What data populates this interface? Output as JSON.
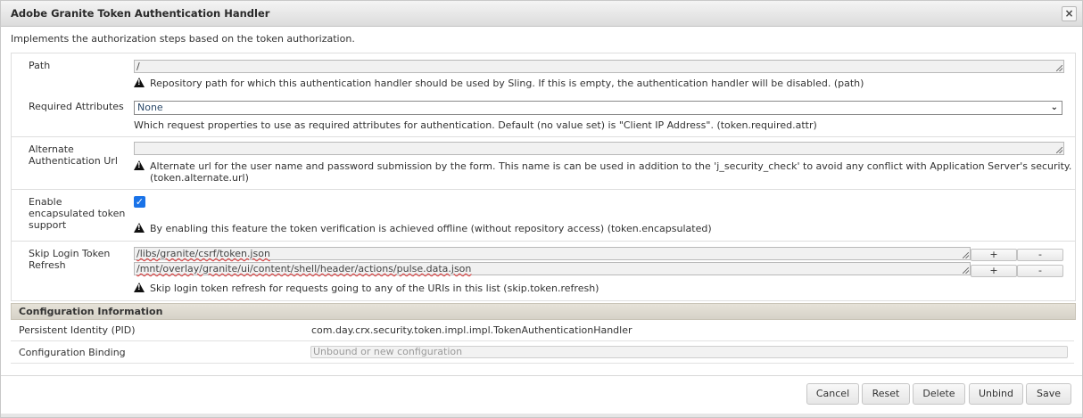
{
  "dialog": {
    "title": "Adobe Granite Token Authentication Handler",
    "close_label": "×",
    "description": "Implements the authorization steps based on the token authorization."
  },
  "fields": {
    "path": {
      "label": "Path",
      "value": "/",
      "hint": "Repository path for which this authentication handler should be used by Sling. If this is empty, the authentication handler will be disabled. (path)"
    },
    "required_attributes": {
      "label": "Required Attributes",
      "selected": "None",
      "hint": "Which request properties to use as required attributes for authentication. Default (no value set) is \"Client IP Address\". (token.required.attr)"
    },
    "alternate_url": {
      "label_line1": "Alternate",
      "label_line2": "Authentication Url",
      "value": "",
      "hint_line1": "Alternate url for the user name and password submission by the form. This name is can be used in addition to the 'j_security_check' to avoid any conflict with Application Server's security.",
      "hint_line2": "(token.alternate.url)"
    },
    "encapsulated": {
      "label_line1": "Enable",
      "label_line2": "encapsulated token",
      "label_line3": "support",
      "checked": true,
      "hint": "By enabling this feature the token verification is achieved offline (without repository access) (token.encapsulated)"
    },
    "skip_refresh": {
      "label_line1": "Skip Login Token",
      "label_line2": "Refresh",
      "values": [
        "/libs/granite/csrf/token.json",
        "/mnt/overlay/granite/ui/content/shell/header/actions/pulse.data.json"
      ],
      "add_label": "+",
      "remove_label": "-",
      "hint": "Skip login token refresh for requests going to any of the URIs in this list (skip.token.refresh)"
    }
  },
  "config_info": {
    "header": "Configuration Information",
    "pid_label": "Persistent Identity (PID)",
    "pid_value": "com.day.crx.security.token.impl.impl.TokenAuthenticationHandler",
    "binding_label": "Configuration Binding",
    "binding_placeholder": "Unbound or new configuration"
  },
  "footer": {
    "cancel": "Cancel",
    "reset": "Reset",
    "delete": "Delete",
    "unbind": "Unbind",
    "save": "Save"
  },
  "icons": {
    "warning": "warning-icon",
    "close": "close-icon",
    "chevron": "chevron-down-icon",
    "check": "check-icon"
  }
}
